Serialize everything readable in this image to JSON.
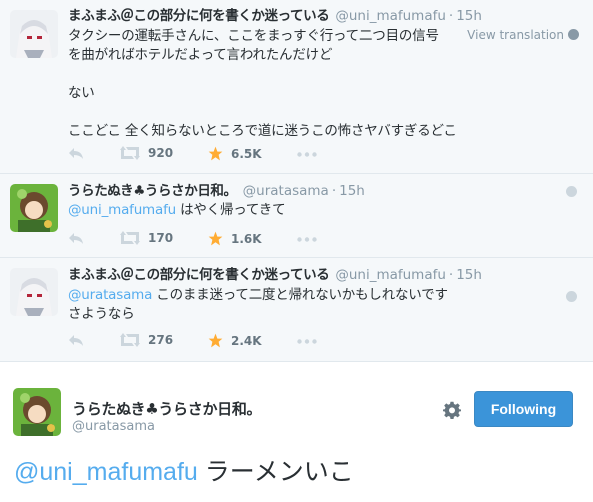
{
  "colors": {
    "accent": "#55acee",
    "star": "#ffac33",
    "muted": "#8899a6",
    "follow_button": "#3b94d9"
  },
  "tweets": [
    {
      "name": "まふまふ＠この部分に何を書くか迷っている",
      "handle": "@uni_mafumafu",
      "time": "15h",
      "view_translation": "View translation",
      "lines": [
        "タクシーの運転手さんに、ここをまっすぐ行って二つ目の信号",
        "を曲がればホテルだよって言われたんだけど",
        "",
        "ない",
        "",
        "ここどこ  全く知らないところで道に迷うこの怖さヤバすぎるどこ"
      ],
      "retweets": "920",
      "favorites": "6.5K"
    },
    {
      "name": "うらたぬき♣うらさか日和。",
      "handle": "@uratasama",
      "time": "15h",
      "mention": "@uni_mafumafu",
      "text": " はやく帰ってきて",
      "retweets": "170",
      "favorites": "1.6K"
    },
    {
      "name": "まふまふ＠この部分に何を書くか迷っている",
      "handle": "@uni_mafumafu",
      "time": "15h",
      "mention": "@uratasama",
      "text": " このまま迷って二度と帰れないかもしれないです",
      "line2": "さようなら",
      "retweets": "276",
      "favorites": "2.4K"
    }
  ],
  "main_tweet": {
    "name": "うらたぬき♣うらさか日和。",
    "handle": "@uratasama",
    "follow_label": "Following",
    "mention": "@uni_mafumafu",
    "text": " ラーメンいこ"
  },
  "icons": [
    "reply-icon",
    "retweet-icon",
    "star-icon",
    "more-icon",
    "globe-icon",
    "gear-icon"
  ]
}
